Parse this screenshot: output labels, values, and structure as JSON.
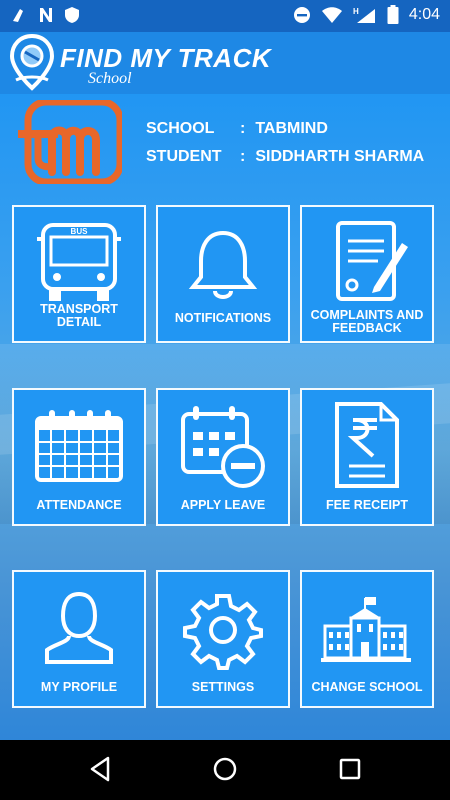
{
  "status": {
    "time": "4:04"
  },
  "header": {
    "title": "FIND MY TRACK",
    "subtitle": "School"
  },
  "profile": {
    "school_label": "SCHOOL",
    "school_value": "TABMIND",
    "student_label": "STUDENT",
    "student_value": "SIDDHARTH SHARMA",
    "separator": ":"
  },
  "tiles": [
    {
      "label": "TRANSPORT DETAIL",
      "icon": "bus-icon"
    },
    {
      "label": "NOTIFICATIONS",
      "icon": "bell-icon"
    },
    {
      "label": "COMPLAINTS AND FEEDBACK",
      "icon": "document-pen-icon"
    },
    {
      "label": "ATTENDANCE",
      "icon": "calendar-icon"
    },
    {
      "label": "APPLY LEAVE",
      "icon": "calendar-minus-icon"
    },
    {
      "label": "FEE RECEIPT",
      "icon": "rupee-receipt-icon"
    },
    {
      "label": "MY PROFILE",
      "icon": "person-icon"
    },
    {
      "label": "SETTINGS",
      "icon": "gear-icon"
    },
    {
      "label": "CHANGE SCHOOL",
      "icon": "school-building-icon"
    }
  ],
  "icons": {
    "bus_sign": "BUS",
    "logo_lettering": "m"
  },
  "colors": {
    "status_bar": "#1565c0",
    "primary": "#1e88e5",
    "logo_orange": "#e8672a"
  }
}
